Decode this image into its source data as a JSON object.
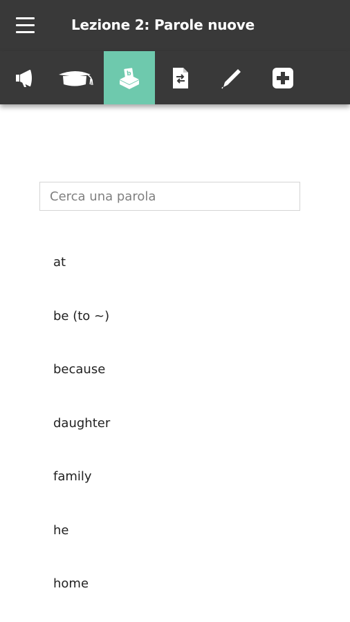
{
  "header": {
    "menu_icon": "hamburger-menu-icon",
    "title": "Lezione 2: Parole nuove"
  },
  "toolbar": {
    "tabs": [
      {
        "icon": "megaphone-icon",
        "active": false
      },
      {
        "icon": "graduation-cap-icon",
        "active": false
      },
      {
        "icon": "vocabulary-box-icon",
        "active": true
      },
      {
        "icon": "document-translate-icon",
        "active": false
      },
      {
        "icon": "pen-icon",
        "active": false
      },
      {
        "icon": "plus-square-icon",
        "active": false
      }
    ],
    "active_color": "#6ec9ad",
    "background_color": "#393939"
  },
  "search": {
    "placeholder": "Cerca una parola",
    "value": ""
  },
  "words": [
    "at",
    "be (to ~)",
    "because",
    "daughter",
    "family",
    "he",
    "home"
  ]
}
